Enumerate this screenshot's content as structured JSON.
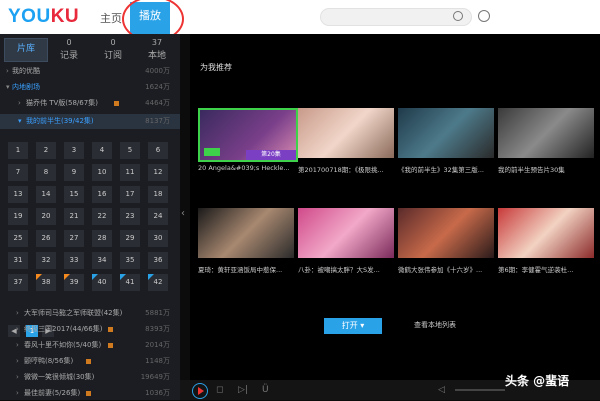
{
  "header": {
    "logo_a": "YOU",
    "logo_b": "KU",
    "nav_home": "主页",
    "nav_play": "播放"
  },
  "sidebar": {
    "tabs": [
      {
        "label": "片库",
        "count": ""
      },
      {
        "label": "记录",
        "count": "0"
      },
      {
        "label": "订阅",
        "count": "0"
      },
      {
        "label": "本地",
        "count": "37"
      }
    ],
    "rows_top": [
      {
        "label": "我的优酷",
        "count": "4000万"
      },
      {
        "label": "内地剧场",
        "count": "1624万"
      },
      {
        "label": "猫乔伟 TV版(58/67集)",
        "count": "4464万"
      },
      {
        "label": "我的前半生(39/42集)",
        "count": "8137万"
      }
    ],
    "episodes": [
      "1",
      "2",
      "3",
      "4",
      "5",
      "6",
      "7",
      "8",
      "9",
      "10",
      "11",
      "12",
      "13",
      "14",
      "15",
      "16",
      "17",
      "18",
      "19",
      "20",
      "21",
      "22",
      "23",
      "24",
      "25",
      "26",
      "27",
      "28",
      "29",
      "30",
      "31",
      "32",
      "33",
      "34",
      "35",
      "36",
      "37",
      "38",
      "39",
      "40",
      "41",
      "42"
    ],
    "page": "1",
    "rows_bottom": [
      {
        "label": "大军师司马懿之军师联盟(42集)",
        "count": "5881万"
      },
      {
        "label": "终极三国2017(44/66集)",
        "count": "8393万"
      },
      {
        "label": "春风十里不如你(5/40集)",
        "count": "2014万"
      },
      {
        "label": "颤哼鸭(8/56集)",
        "count": "1148万"
      },
      {
        "label": "微微一笑很倾城(30集)",
        "count": "19649万"
      },
      {
        "label": "最佳前妻(5/26集)",
        "count": "1036万"
      }
    ]
  },
  "main": {
    "section_title": "为我推荐",
    "row1_captions": [
      "20 Angela&#039;s Heckle...",
      "第201700718期：《极限挑...",
      "《我的前半生》32集第三版...",
      "我的前半生预告片30集"
    ],
    "row1_badge": "第20集",
    "row2_captions": [
      "夏琦：黄轩亚涵饭局中惹保...",
      "八卦：被嘲搞太胖？大S发...",
      "微鹤大张伟参加《十六岁》...",
      "第6期：李健霍气逆袭杜..."
    ],
    "open_label": "打开 ▾",
    "local_label": "查看本地列表"
  },
  "watermark": "头条 @蜚语",
  "colors": {
    "accent": "#2aa2e8",
    "lock": "#d07a1f",
    "highlight": "#3aa0ff"
  }
}
